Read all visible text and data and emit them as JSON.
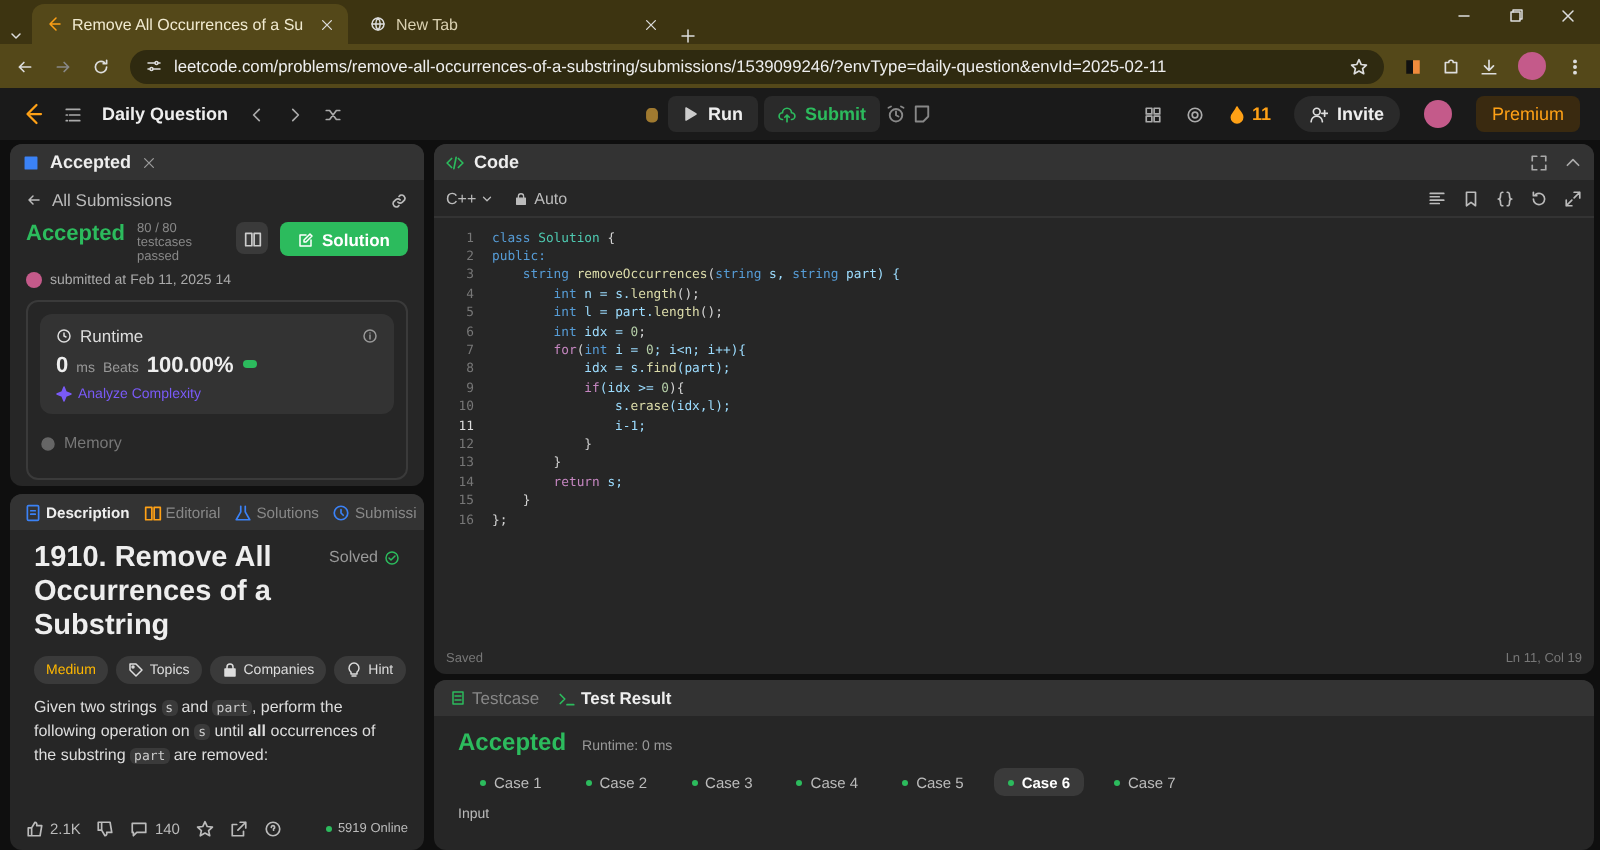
{
  "browser": {
    "tabs": [
      {
        "title": "Remove All Occurrences of a Su",
        "selected": true
      },
      {
        "title": "New Tab",
        "selected": false
      }
    ],
    "url": "leetcode.com/problems/remove-all-occurrences-of-a-substring/submissions/1539099246/?envType=daily-question&envId=2025-02-11"
  },
  "nav": {
    "title": "Daily Question",
    "run": "Run",
    "submit": "Submit",
    "streak": "11",
    "invite": "Invite",
    "premium": "Premium"
  },
  "submission": {
    "tab": "Accepted",
    "back": "All Submissions",
    "status": "Accepted",
    "testcases": "80 / 80 testcases passed",
    "submitted": "submitted at Feb 11, 2025 14",
    "solution": "Solution",
    "runtime": {
      "label": "Runtime",
      "value": "0",
      "unit": "ms",
      "beats_label": "Beats",
      "beats": "100.00%",
      "analyze": "Analyze Complexity"
    },
    "memory": "Memory"
  },
  "description": {
    "tabs": [
      {
        "label": "Description",
        "kind": "description",
        "selected": true
      },
      {
        "label": "Editorial",
        "kind": "editorial",
        "selected": false
      },
      {
        "label": "Solutions",
        "kind": "solutions",
        "selected": false
      },
      {
        "label": "Submissi",
        "kind": "submissions",
        "selected": false
      }
    ],
    "title": "1910. Remove All Occurrences of a Substring",
    "solved": "Solved",
    "tags": [
      {
        "label": "Medium",
        "kind": "difficulty"
      },
      {
        "label": "Topics",
        "kind": "topics"
      },
      {
        "label": "Companies",
        "kind": "companies"
      },
      {
        "label": "Hint",
        "kind": "hint"
      }
    ],
    "paragraph": [
      {
        "text": "Given two strings ",
        "kind": "text"
      },
      {
        "text": "s",
        "kind": "code"
      },
      {
        "text": " and ",
        "kind": "text"
      },
      {
        "text": "part",
        "kind": "code"
      },
      {
        "text": ", perform the following operation on ",
        "kind": "text"
      },
      {
        "text": "s",
        "kind": "code"
      },
      {
        "text": " until ",
        "kind": "text"
      },
      {
        "text": "all",
        "kind": "bold"
      },
      {
        "text": " occurrences of the substring ",
        "kind": "text"
      },
      {
        "text": "part",
        "kind": "code"
      },
      {
        "text": " are removed:",
        "kind": "text"
      }
    ],
    "likes": "2.1K",
    "comments": "140",
    "online": "5919 Online"
  },
  "editor": {
    "title": "Code",
    "language": "C++",
    "mode": "Auto",
    "lines": [
      {
        "number": "1",
        "tokens": [
          {
            "text": "class",
            "kind": "kw"
          },
          {
            "text": " Solution",
            "kind": "type"
          },
          {
            "text": " {",
            "kind": "p"
          }
        ]
      },
      {
        "number": "2",
        "tokens": [
          {
            "text": "public:",
            "kind": "kw"
          }
        ]
      },
      {
        "number": "3",
        "tokens": [
          {
            "text": "    string",
            "kind": "kw"
          },
          {
            "text": " removeOccurrences",
            "kind": "fn"
          },
          {
            "text": "(",
            "kind": "p"
          },
          {
            "text": "string",
            "kind": "kw"
          },
          {
            "text": " s, ",
            "kind": "var"
          },
          {
            "text": "string",
            "kind": "kw"
          },
          {
            "text": " part) {",
            "kind": "var"
          }
        ]
      },
      {
        "number": "4",
        "tokens": [
          {
            "text": "        int",
            "kind": "kw"
          },
          {
            "text": " n = s.",
            "kind": "var"
          },
          {
            "text": "length",
            "kind": "fn"
          },
          {
            "text": "();",
            "kind": "p"
          }
        ]
      },
      {
        "number": "5",
        "tokens": [
          {
            "text": "        int",
            "kind": "kw"
          },
          {
            "text": " l = part.",
            "kind": "var"
          },
          {
            "text": "length",
            "kind": "fn"
          },
          {
            "text": "();",
            "kind": "p"
          }
        ]
      },
      {
        "number": "6",
        "tokens": [
          {
            "text": "        int",
            "kind": "kw"
          },
          {
            "text": " idx = ",
            "kind": "var"
          },
          {
            "text": "0",
            "kind": "num"
          },
          {
            "text": ";",
            "kind": "p"
          }
        ]
      },
      {
        "number": "7",
        "tokens": [
          {
            "text": "        for",
            "kind": "ctl"
          },
          {
            "text": "(",
            "kind": "p"
          },
          {
            "text": "int",
            "kind": "kw"
          },
          {
            "text": " i = ",
            "kind": "var"
          },
          {
            "text": "0",
            "kind": "num"
          },
          {
            "text": "; i<n; i++){",
            "kind": "var"
          }
        ]
      },
      {
        "number": "8",
        "tokens": [
          {
            "text": "            idx = s.",
            "kind": "var"
          },
          {
            "text": "find",
            "kind": "fn"
          },
          {
            "text": "(part);",
            "kind": "var"
          }
        ]
      },
      {
        "number": "9",
        "tokens": [
          {
            "text": "            if",
            "kind": "ctl"
          },
          {
            "text": "(idx >= ",
            "kind": "var"
          },
          {
            "text": "0",
            "kind": "num"
          },
          {
            "text": "){",
            "kind": "p"
          }
        ]
      },
      {
        "number": "10",
        "tokens": [
          {
            "text": "                s.",
            "kind": "var"
          },
          {
            "text": "erase",
            "kind": "fn"
          },
          {
            "text": "(idx,l);",
            "kind": "var"
          }
        ]
      },
      {
        "number": "11",
        "tokens": [
          {
            "text": "                i-1;",
            "kind": "var"
          }
        ]
      },
      {
        "number": "12",
        "tokens": [
          {
            "text": "            }",
            "kind": "p"
          }
        ]
      },
      {
        "number": "13",
        "tokens": [
          {
            "text": "        }",
            "kind": "p"
          }
        ]
      },
      {
        "number": "14",
        "tokens": [
          {
            "text": "        return",
            "kind": "ctl"
          },
          {
            "text": " s;",
            "kind": "var"
          }
        ]
      },
      {
        "number": "15",
        "tokens": [
          {
            "text": "    }",
            "kind": "p"
          }
        ]
      },
      {
        "number": "16",
        "tokens": [
          {
            "text": "};",
            "kind": "p"
          }
        ]
      }
    ],
    "status": "Saved",
    "position": "Ln 11, Col 19"
  },
  "tests": {
    "tabs": [
      {
        "label": "Testcase",
        "selected": false
      },
      {
        "label": "Test Result",
        "selected": true
      }
    ],
    "status": "Accepted",
    "runtime": "Runtime: 0 ms",
    "cases": [
      {
        "label": "Case 1",
        "selected": false
      },
      {
        "label": "Case 2",
        "selected": false
      },
      {
        "label": "Case 3",
        "selected": false
      },
      {
        "label": "Case 4",
        "selected": false
      },
      {
        "label": "Case 5",
        "selected": false
      },
      {
        "label": "Case 6",
        "selected": true
      },
      {
        "label": "Case 7",
        "selected": false
      }
    ],
    "input_label": "Input"
  }
}
